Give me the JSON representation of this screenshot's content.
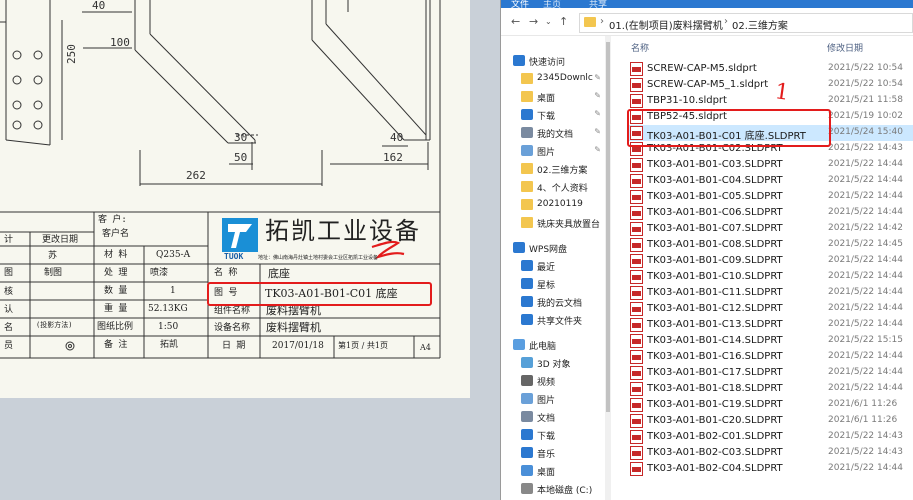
{
  "cad": {
    "dims": [
      "40",
      "100",
      "250",
      "262",
      "50",
      "30",
      "162",
      "162",
      "40"
    ],
    "title_block": {
      "company": "拓凯工业设备",
      "logo_text": "TUOK",
      "address_line": "地址：佛山南海丹灶镇土地村委会工业区拓凯工业设备",
      "customer_label": "客 户:",
      "customer_name_label": "客户名",
      "left_col": [
        "计",
        "图",
        "核",
        "认",
        "名",
        "员"
      ],
      "row1_a": "苏",
      "row1_b": "更改日期",
      "row2_a": "制图",
      "rows": [
        {
          "label": "材 料",
          "value": "Q235-A"
        },
        {
          "label": "处 理",
          "value": "喷漆"
        },
        {
          "label": "数 量",
          "value": "1"
        },
        {
          "label": "重 量",
          "value": "52.13KG"
        },
        {
          "label": "图纸比例",
          "value": "1:50"
        },
        {
          "label": "备 注",
          "value": "拓凯"
        }
      ],
      "projection_label": "(投影方法)",
      "name_label": "名 称",
      "name_value": "底座",
      "drawing_no_label": "图 号",
      "drawing_no_value": "TK03-A01-B01-C01 底座",
      "group_label": "组件名称",
      "group_value": "废料摆臂机",
      "equip_label": "设备名称",
      "equip_value": "废料摆臂机",
      "date_label": "日 期",
      "date_value": "2017/01/18",
      "sheet_value": "第1页 / 共1页",
      "size_value": "A4"
    }
  },
  "explorer": {
    "ribbon_tabs": [
      "文件",
      "主页",
      "共享"
    ],
    "breadcrumbs": [
      "01.(在制项目)废料摆臂机",
      "02.三维方案"
    ],
    "columns": {
      "name": "名称",
      "date": "修改日期"
    },
    "nav_items": [
      {
        "label": "快速访问",
        "icon": "star-icon",
        "pinned": false
      },
      {
        "label": "2345Downlc",
        "icon": "folder-icon",
        "pinned": true
      },
      {
        "label": "桌面",
        "icon": "folder-icon",
        "pinned": true
      },
      {
        "label": "下载",
        "icon": "download-icon",
        "pinned": true
      },
      {
        "label": "我的文档",
        "icon": "document-icon",
        "pinned": true
      },
      {
        "label": "图片",
        "icon": "picture-icon",
        "pinned": true
      },
      {
        "label": "02.三维方案",
        "icon": "folder-icon",
        "pinned": false
      },
      {
        "label": "4、个人资料",
        "icon": "folder-icon",
        "pinned": false
      },
      {
        "label": "20210119",
        "icon": "folder-icon",
        "pinned": false
      },
      {
        "label": "铣床夹具放置台",
        "icon": "folder-icon",
        "pinned": false
      },
      {
        "label": "WPS网盘",
        "icon": "cloud-icon",
        "pinned": false
      },
      {
        "label": "最近",
        "icon": "clock-icon",
        "pinned": false
      },
      {
        "label": "星标",
        "icon": "star-icon",
        "pinned": false
      },
      {
        "label": "我的云文档",
        "icon": "cloud-icon",
        "pinned": false
      },
      {
        "label": "共享文件夹",
        "icon": "share-icon",
        "pinned": false
      },
      {
        "label": "此电脑",
        "icon": "computer-icon",
        "pinned": false
      },
      {
        "label": "3D 对象",
        "icon": "cube-icon",
        "pinned": false
      },
      {
        "label": "视频",
        "icon": "video-icon",
        "pinned": false
      },
      {
        "label": "图片",
        "icon": "picture-icon",
        "pinned": false
      },
      {
        "label": "文档",
        "icon": "document-icon",
        "pinned": false
      },
      {
        "label": "下载",
        "icon": "download-icon",
        "pinned": false
      },
      {
        "label": "音乐",
        "icon": "music-icon",
        "pinned": false
      },
      {
        "label": "桌面",
        "icon": "desktop-icon",
        "pinned": false
      },
      {
        "label": "本地磁盘 (C:)",
        "icon": "drive-icon",
        "pinned": false
      }
    ],
    "files": [
      {
        "name": "SCREW-CAP-M5.sldprt",
        "date": "2021/5/22 10:54"
      },
      {
        "name": "SCREW-CAP-M5_1.sldprt",
        "date": "2021/5/22 10:54"
      },
      {
        "name": "TBP31-10.sldprt",
        "date": "2021/5/21 11:58"
      },
      {
        "name": "TBP52-45.sldprt",
        "date": "2021/5/19 10:02"
      },
      {
        "name": "TK03-A01-B01-C01 底座.SLDPRT",
        "date": "2021/5/24 15:40",
        "selected": true
      },
      {
        "name": "TK03-A01-B01-C02.SLDPRT",
        "date": "2021/5/22 14:43"
      },
      {
        "name": "TK03-A01-B01-C03.SLDPRT",
        "date": "2021/5/22 14:44"
      },
      {
        "name": "TK03-A01-B01-C04.SLDPRT",
        "date": "2021/5/22 14:44"
      },
      {
        "name": "TK03-A01-B01-C05.SLDPRT",
        "date": "2021/5/22 14:44"
      },
      {
        "name": "TK03-A01-B01-C06.SLDPRT",
        "date": "2021/5/22 14:44"
      },
      {
        "name": "TK03-A01-B01-C07.SLDPRT",
        "date": "2021/5/22 14:42"
      },
      {
        "name": "TK03-A01-B01-C08.SLDPRT",
        "date": "2021/5/22 14:45"
      },
      {
        "name": "TK03-A01-B01-C09.SLDPRT",
        "date": "2021/5/22 14:44"
      },
      {
        "name": "TK03-A01-B01-C10.SLDPRT",
        "date": "2021/5/22 14:44"
      },
      {
        "name": "TK03-A01-B01-C11.SLDPRT",
        "date": "2021/5/22 14:44"
      },
      {
        "name": "TK03-A01-B01-C12.SLDPRT",
        "date": "2021/5/22 14:44"
      },
      {
        "name": "TK03-A01-B01-C13.SLDPRT",
        "date": "2021/5/22 14:44"
      },
      {
        "name": "TK03-A01-B01-C14.SLDPRT",
        "date": "2021/5/22 15:15"
      },
      {
        "name": "TK03-A01-B01-C16.SLDPRT",
        "date": "2021/5/22 14:44"
      },
      {
        "name": "TK03-A01-B01-C17.SLDPRT",
        "date": "2021/5/22 14:44"
      },
      {
        "name": "TK03-A01-B01-C18.SLDPRT",
        "date": "2021/5/22 14:44"
      },
      {
        "name": "TK03-A01-B01-C19.SLDPRT",
        "date": "2021/6/1 11:26"
      },
      {
        "name": "TK03-A01-B01-C20.SLDPRT",
        "date": "2021/6/1 11:26"
      },
      {
        "name": "TK03-A01-B02-C01.SLDPRT",
        "date": "2021/5/22 14:43"
      },
      {
        "name": "TK03-A01-B02-C03.SLDPRT",
        "date": "2021/5/22 14:43"
      },
      {
        "name": "TK03-A01-B02-C04.SLDPRT",
        "date": "2021/5/22 14:44"
      }
    ],
    "annotation_mark": "1"
  },
  "colors": {
    "ribbon": "#2b78d0",
    "selection": "#cce8ff",
    "annotation": "#e31c1c",
    "folder": "#f3c64f"
  }
}
